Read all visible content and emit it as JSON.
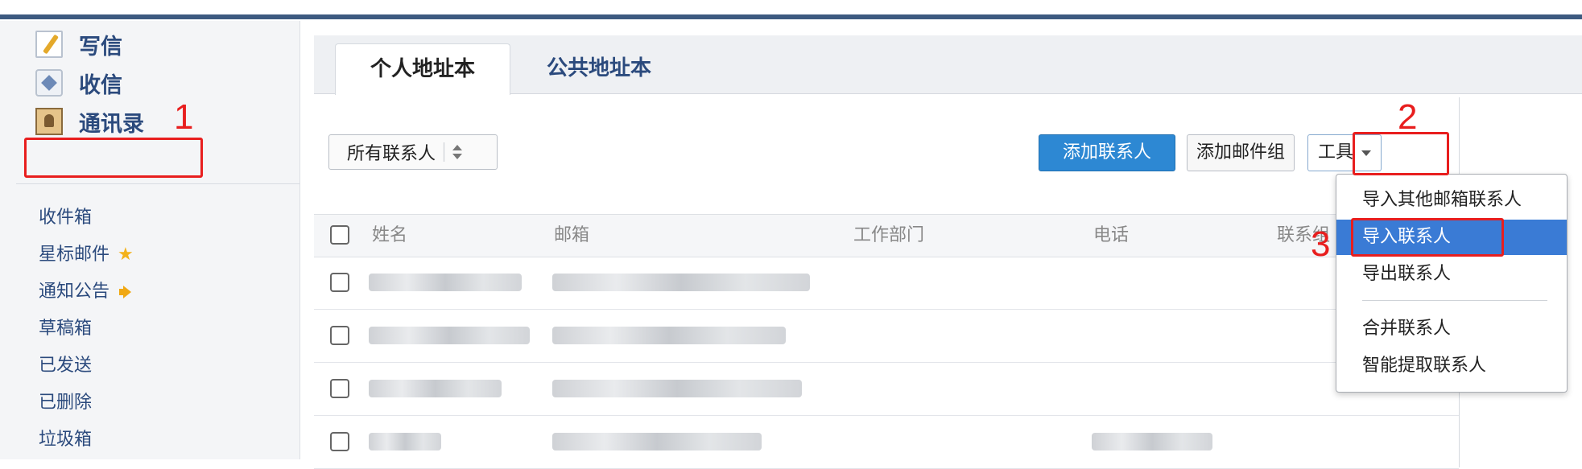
{
  "sidebar": {
    "main_items": [
      {
        "label": "写信",
        "icon": "compose-icon"
      },
      {
        "label": "收信",
        "icon": "inbox-icon"
      },
      {
        "label": "通讯录",
        "icon": "contacts-icon"
      }
    ],
    "folders": [
      {
        "label": "收件箱"
      },
      {
        "label": "星标邮件",
        "icon": "star-icon"
      },
      {
        "label": "通知公告",
        "icon": "speaker-icon"
      },
      {
        "label": "草稿箱"
      },
      {
        "label": "已发送"
      },
      {
        "label": "已删除"
      },
      {
        "label": "垃圾箱"
      }
    ]
  },
  "tabs": [
    {
      "label": "个人地址本",
      "active": true
    },
    {
      "label": "公共地址本",
      "active": false
    }
  ],
  "toolbar": {
    "filter_label": "所有联系人",
    "add_contact": "添加联系人",
    "add_group": "添加邮件组",
    "tools": "工具"
  },
  "table": {
    "columns": [
      "姓名",
      "邮箱",
      "工作部门",
      "电话",
      "联系组"
    ],
    "rows": [
      {
        "name": "",
        "email": "",
        "phone": ""
      },
      {
        "name": "",
        "email": "",
        "phone": ""
      },
      {
        "name": "",
        "email": "",
        "phone": ""
      },
      {
        "name": "",
        "email": "",
        "phone": ""
      }
    ]
  },
  "tools_menu": {
    "items": [
      "导入其他邮箱联系人",
      "导入联系人",
      "导出联系人",
      "合并联系人",
      "智能提取联系人"
    ],
    "selected": "导入联系人"
  },
  "annotations": [
    "1",
    "2",
    "3"
  ],
  "colors": {
    "primary_button": "#2d88d3",
    "annotation": "#e81e1e",
    "menu_highlight": "#3a7bd5",
    "nav_text": "#2b4a7d"
  }
}
